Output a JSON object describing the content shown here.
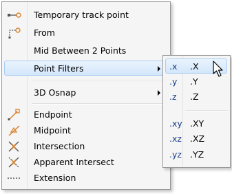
{
  "menu": {
    "items": [
      {
        "label": "Temporary track point",
        "icon": "temporary-track-point-icon"
      },
      {
        "label": "From",
        "icon": "from-icon"
      },
      {
        "label": "Mid Between 2 Points",
        "icon": null
      },
      {
        "label": "Point Filters",
        "icon": null,
        "has_submenu": true,
        "highlighted": true
      },
      {
        "label": "3D Osnap",
        "icon": null,
        "has_submenu": true
      },
      {
        "label": "Endpoint",
        "icon": "endpoint-icon"
      },
      {
        "label": "Midpoint",
        "icon": "midpoint-icon"
      },
      {
        "label": "Intersection",
        "icon": "intersection-icon"
      },
      {
        "label": "Apparent Intersect",
        "icon": "apparent-intersect-icon"
      },
      {
        "label": "Extension",
        "icon": "extension-icon"
      }
    ]
  },
  "submenu": {
    "items": [
      {
        "icon_text": ".x",
        "label": ".X",
        "highlighted": true
      },
      {
        "icon_text": ".y",
        "label": ".Y"
      },
      {
        "icon_text": ".z",
        "label": ".Z"
      },
      {
        "icon_text": ".xy",
        "label": ".XY"
      },
      {
        "icon_text": ".xz",
        "label": ".XZ"
      },
      {
        "icon_text": ".yz",
        "label": ".YZ"
      }
    ]
  },
  "colors": {
    "highlight_top": "#e9f3fd",
    "highlight_bottom": "#d4e7fb",
    "highlight_border": "#a8cdf2",
    "icon_accent": "#d9822b",
    "filter_text": "#1a3f8a"
  }
}
